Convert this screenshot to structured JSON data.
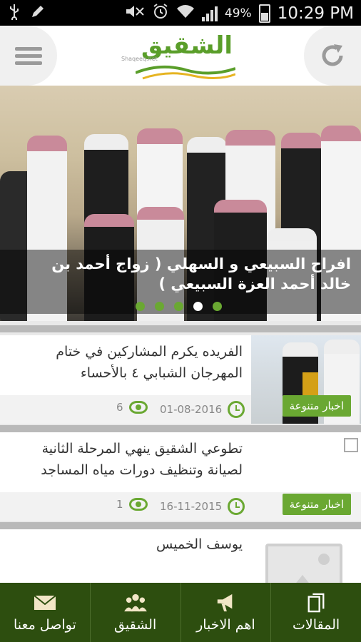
{
  "status_bar": {
    "time": "10:29 PM",
    "battery_percent": "49%",
    "left_icons": [
      "usb-icon",
      "edit-icon"
    ],
    "right_icons": [
      "mute-icon",
      "alarm-icon",
      "wifi-icon",
      "signal-icon",
      "battery-icon"
    ]
  },
  "app_bar": {
    "logo_text": "الشقيق",
    "logo_subtext": "Shaqeeq.net",
    "menu_icon": "hamburger-menu-icon",
    "refresh_icon": "refresh-icon"
  },
  "hero": {
    "title": "افراح السبيعي و السهلي ( زواج أحمد بن خالد أحمد العزة السبيعي )",
    "dot_count": 5,
    "active_dot": 4
  },
  "articles": [
    {
      "title": "الفريده يكرم المشاركين في ختام المهرجان الشبابي ٤ بالأحساء",
      "date": "01-08-2016",
      "views": "6",
      "category": "اخبار متنوعة",
      "has_image": true
    },
    {
      "title": "تطوعي الشقيق ينهي المرحلة الثانية لصيانة وتنظيف دورات مياه المساجد",
      "date": "16-11-2015",
      "views": "1",
      "category": "اخبار متنوعة",
      "has_image": false
    },
    {
      "title": "يوسف الخميس",
      "has_image": false
    }
  ],
  "bottom_nav": [
    {
      "label": "المقالات",
      "icon": "documents-icon"
    },
    {
      "label": "اهم الاخبار",
      "icon": "megaphone-icon"
    },
    {
      "label": "الشقيق",
      "icon": "people-icon"
    },
    {
      "label": "تواصل معنا",
      "icon": "mail-icon"
    }
  ],
  "colors": {
    "accent_green": "#6aa832",
    "nav_background": "#2d4e0f"
  }
}
